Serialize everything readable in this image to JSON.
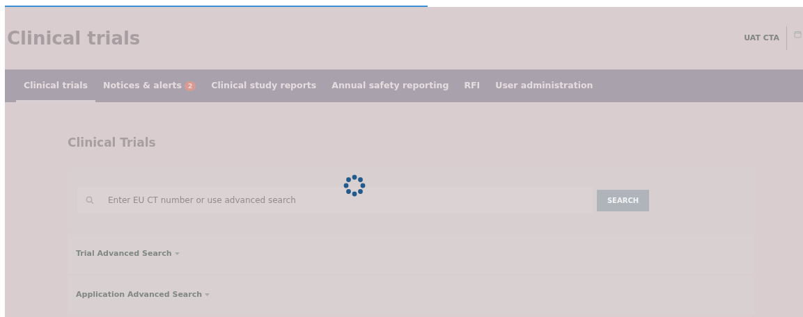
{
  "loading_bar": {
    "level": 0.53
  },
  "header": {
    "title": "Clinical trials",
    "user": "UAT CTA"
  },
  "tabs": [
    {
      "label": "Clinical trials",
      "selected": true
    },
    {
      "label": "Notices & alerts",
      "badge": "2",
      "selected": false
    },
    {
      "label": "Clinical study reports",
      "selected": false
    },
    {
      "label": "Annual safety reporting",
      "selected": false
    },
    {
      "label": "RFI",
      "selected": false
    },
    {
      "label": "User administration",
      "selected": false
    }
  ],
  "page_title": "Clinical Trials",
  "search": {
    "placeholder": "Enter EU CT number or use advanced search",
    "button": "SEARCH"
  },
  "sections": [
    {
      "label": "Trial Advanced Search",
      "expanded": false
    },
    {
      "label": "Application Advanced Search",
      "expanded": false
    }
  ]
}
